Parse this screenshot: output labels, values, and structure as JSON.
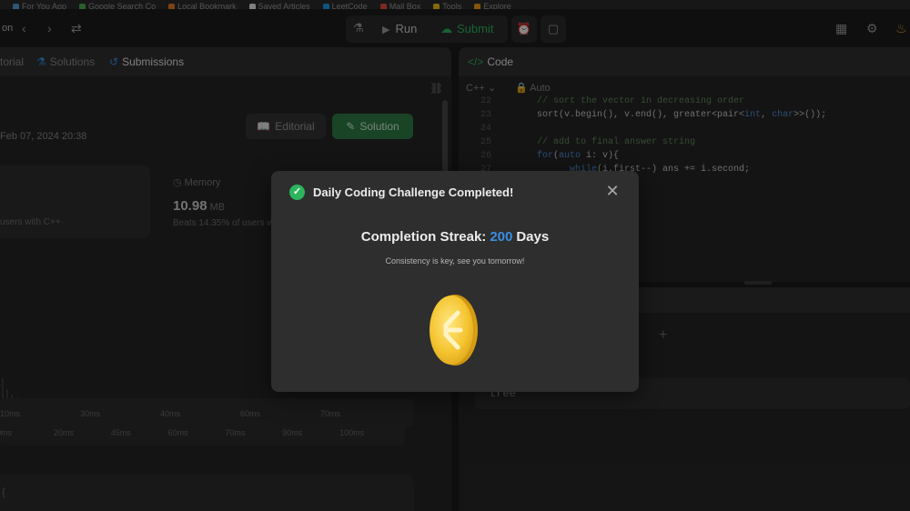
{
  "bookmarks": [
    "For You App",
    "Google Search Co",
    "Local Bookmark",
    "Saved Articles",
    "LeetCode",
    "Mail Box",
    "Tools",
    "Explore"
  ],
  "topbar": {
    "run_label": "Run",
    "submit_label": "Submit"
  },
  "left_panel": {
    "tabs": {
      "editorial": "torial",
      "solutions": "Solutions",
      "submissions": "Submissions"
    },
    "submitted_date": "Feb 07, 2024 20:38",
    "editorial_button": "Editorial",
    "solution_button": "Solution",
    "runtime_beats": "users with C++",
    "memory": {
      "label": "Memory",
      "value": "10.98",
      "unit": "MB",
      "beats": "Beats 14.35% of users w"
    },
    "axis_top_ticks": [
      "10ms",
      "30ms",
      "40ms",
      "60ms",
      "70ms"
    ],
    "axis_bottom_ticks": [
      "0ms",
      "20ms",
      "45ms",
      "60ms",
      "70ms",
      "90ms",
      "100ms"
    ],
    "lower_snippet": "{"
  },
  "code_panel": {
    "title": "Code",
    "language": "C++",
    "auto_label": "Auto",
    "lines": [
      {
        "ln": "22",
        "html": "<span class=\"cm\">// sort the vector in decreasing order</span>"
      },
      {
        "ln": "23",
        "html": "sort(v.begin(), v.end(), greater&lt;pair&lt;<span class=\"kw\">int</span>, <span class=\"kw\">char</span>&gt;&gt;());"
      },
      {
        "ln": "24",
        "html": ""
      },
      {
        "ln": "25",
        "html": "<span class=\"cm\">// add to final answer string</span>"
      },
      {
        "ln": "26",
        "html": "<span class=\"kw\">for</span>(<span class=\"kw\">auto</span> i: v){"
      },
      {
        "ln": "27",
        "html": "    <span class=\"kw\">while</span>(i.first--) ans += i.second;"
      }
    ]
  },
  "testcase_panel": {
    "case_value": "tree"
  },
  "modal": {
    "title": "Daily Coding Challenge Completed!",
    "streak_label": "Completion Streak:",
    "streak_value": "200",
    "streak_unit": "Days",
    "message": "Consistency is key, see you tomorrow!"
  },
  "colors": {
    "accent_green": "#2db55d",
    "accent_blue": "#3a8ee6",
    "coin_gold": "#f2c230"
  }
}
